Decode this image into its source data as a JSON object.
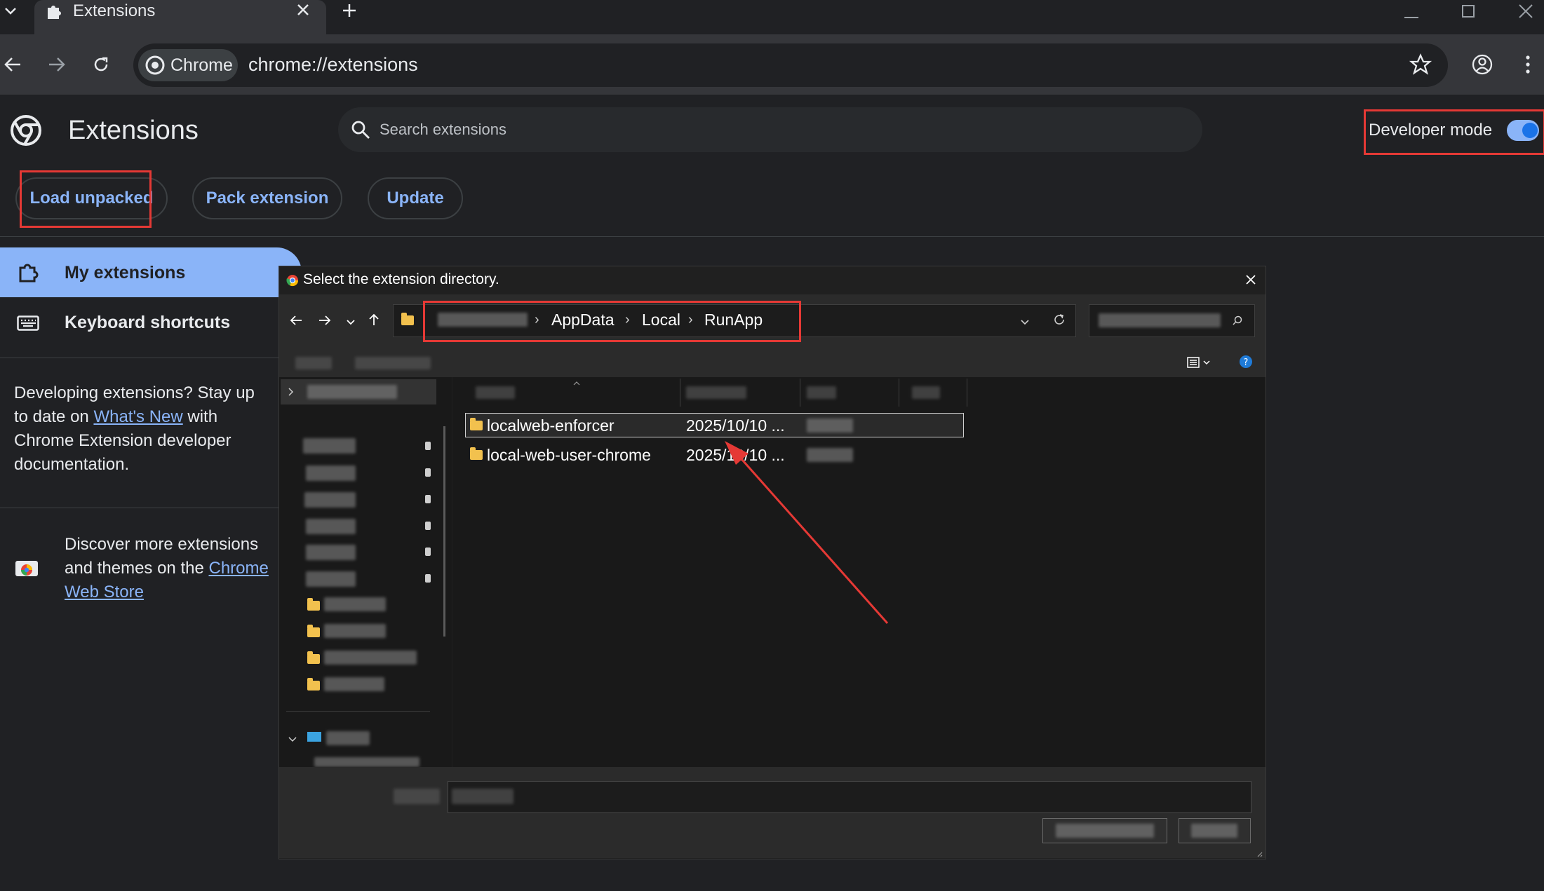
{
  "browser": {
    "tab_title": "Extensions",
    "chrome_chip_label": "Chrome",
    "url": "chrome://extensions"
  },
  "header": {
    "title": "Extensions",
    "search_placeholder": "Search extensions",
    "developer_mode_label": "Developer mode",
    "developer_mode_on": true
  },
  "toolbar_buttons": {
    "load_unpacked": "Load unpacked",
    "pack_extension": "Pack extension",
    "update": "Update"
  },
  "sidebar": {
    "my_extensions": "My extensions",
    "keyboard_shortcuts": "Keyboard shortcuts",
    "dev_text_1": "Developing extensions? Stay up to date on ",
    "whats_new_link": "What's New",
    "dev_text_2": " with Chrome Extension developer documentation.",
    "store_text": "Discover more extensions and themes on the ",
    "web_store_link": "Chrome Web Store"
  },
  "dialog": {
    "title": "Select the extension directory.",
    "breadcrumbs": [
      "AppData",
      "Local",
      "RunApp"
    ],
    "files": [
      {
        "name": "localweb-enforcer",
        "date": "2025/10/10 ..."
      },
      {
        "name": "local-web-user-chrome",
        "date": "2025/10/10 ..."
      }
    ]
  },
  "colors": {
    "highlight_red": "#e53935",
    "accent_blue": "#8ab4f8",
    "folder_yellow": "#f2c14e",
    "arrow_red": "#e53935"
  }
}
